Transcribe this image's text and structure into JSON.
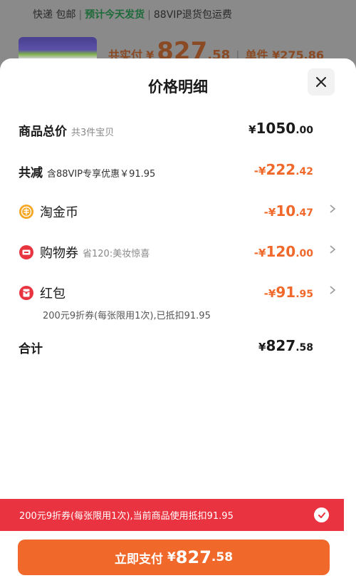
{
  "background": {
    "shipping": {
      "courier": "快递 包邮",
      "ship_today": "预计今天发货",
      "vip_return": "88VIP退货包运费"
    },
    "price_summary": {
      "paid_label": "共实付",
      "currency": "¥",
      "paid_int": "827",
      "paid_dec": ".58",
      "unit_label": "单件 ¥275.86"
    }
  },
  "sheet": {
    "title": "价格明细",
    "rows": {
      "total": {
        "label": "商品总价",
        "sub": "共3件宝贝",
        "currency": "¥",
        "int": "1050",
        "dec": ".00"
      },
      "discount": {
        "label": "共减",
        "sub": "含88VIP专享优惠￥91.95",
        "currency": "-¥",
        "int": "222",
        "dec": ".42"
      },
      "taojinbi": {
        "label": "淘金币",
        "currency": "-¥",
        "int": "10",
        "dec": ".47"
      },
      "coupon": {
        "label": "购物券",
        "sub": "省120:美妆惊喜",
        "currency": "-¥",
        "int": "120",
        "dec": ".00"
      },
      "redpacket": {
        "label": "红包",
        "currency": "-¥",
        "int": "91",
        "dec": ".95",
        "note": "200元9折券(每张限用1次),已抵扣91.95"
      },
      "sum": {
        "label": "合计",
        "currency": "¥",
        "int": "827",
        "dec": ".58"
      }
    },
    "banner": {
      "text": "200元9折券(每张限用1次),当前商品使用抵扣91.95"
    },
    "pay_button": {
      "label": "立即支付",
      "currency": "¥",
      "int": "827",
      "dec": ".58"
    }
  },
  "colors": {
    "accent_orange": "#f0682a",
    "banner_red": "#ea3340",
    "coin_gold": "#f5a623",
    "coupon_red": "#e8343f"
  },
  "icons": {
    "close": "close-icon",
    "taojinbi": "gold-coin-icon",
    "coupon": "ticket-icon",
    "redpacket": "red-envelope-icon",
    "chevron": "chevron-right-icon",
    "check": "check-circle-icon"
  }
}
